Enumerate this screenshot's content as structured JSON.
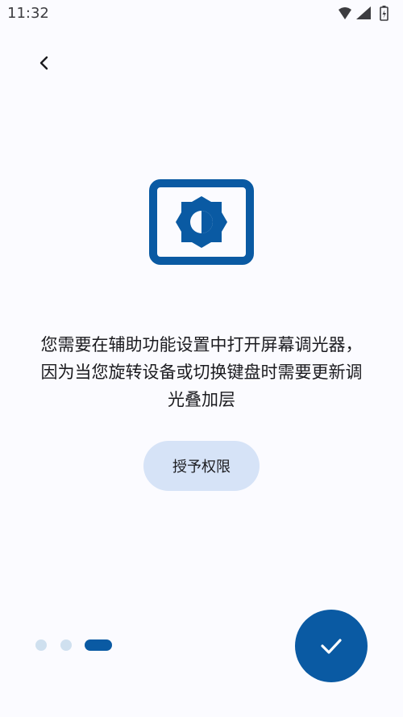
{
  "status_bar": {
    "time": "11:32",
    "icons": [
      "wifi-icon",
      "signal-icon",
      "battery-charging-icon"
    ]
  },
  "navigation": {
    "back_icon": "back-arrow-icon"
  },
  "hero": {
    "icon": "screen-brightness-icon",
    "color": "#0a5aa3"
  },
  "message": {
    "line1": "您需要在辅助功能设置中打开屏幕调光器，",
    "line2": "因为当您旋转设备或切换键盘时需要更新调",
    "line3": "光叠加层"
  },
  "grant_button": {
    "label": "授予权限"
  },
  "pager": {
    "pages": 3,
    "current_index": 2,
    "active_color": "#0a5aa3",
    "inactive_color": "#cfe0ef"
  },
  "fab": {
    "icon": "check-icon",
    "color": "#0a5aa3"
  }
}
